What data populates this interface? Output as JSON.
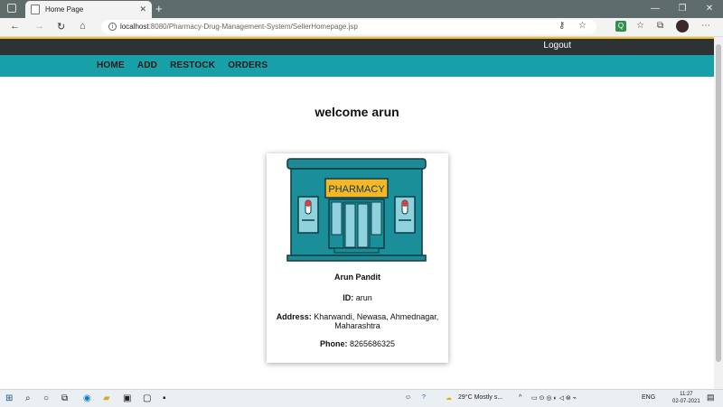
{
  "browser": {
    "tab_title": "Home Page",
    "tab_close": "✕",
    "new_tab": "+",
    "url_host": "localhost",
    "url_path": ":8080/Pharmacy-Drug-Management-System/SellerHomepage.jsp",
    "window_buttons": [
      "—",
      "❐",
      "✕"
    ]
  },
  "header": {
    "logout_label": "Logout"
  },
  "nav": {
    "items": [
      "HOME",
      "ADD",
      "RESTOCK",
      "ORDERS"
    ]
  },
  "main": {
    "welcome": "welcome arun",
    "card": {
      "image_text": "PHARMACY",
      "name": "Arun Pandit",
      "id_label": "ID:",
      "id_value": "arun",
      "address_label": "Address:",
      "address_value": "Kharwandi, Newasa, Ahmednagar,",
      "address_value2": "Maharashtra",
      "phone_label": "Phone:",
      "phone_value": "8265686325"
    }
  },
  "taskbar": {
    "weather": "29°C  Mostly s...",
    "lang": "ENG",
    "time": "11:27",
    "date": "02-07-2021"
  },
  "colors": {
    "navbar": "#17a0a8",
    "topbar": "#2f3233"
  }
}
